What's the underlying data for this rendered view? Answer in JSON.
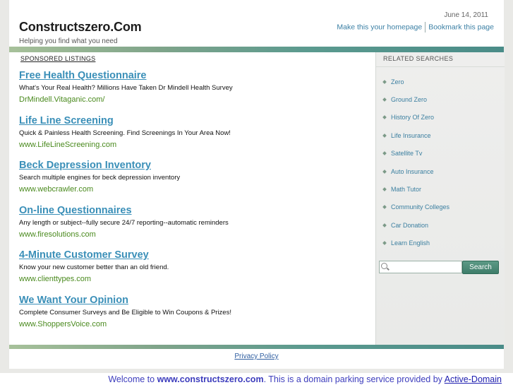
{
  "header": {
    "site_title": "Constructszero.Com",
    "tagline": "Helping you find what you need",
    "date": "June 14, 2011",
    "make_homepage": "Make this your homepage",
    "bookmark": "Bookmark this page"
  },
  "sponsored": {
    "label": "SPONSORED LISTINGS",
    "listings": [
      {
        "title": "Free Health Questionnaire",
        "desc": "What's Your Real Health? Millions Have Taken Dr Mindell Health Survey",
        "url": "DrMindell.Vitaganic.com/"
      },
      {
        "title": "Life Line Screening",
        "desc": "Quick & Painless Health Screening. Find Screenings In Your Area Now!",
        "url": "www.LifeLineScreening.com"
      },
      {
        "title": "Beck Depression Inventory",
        "desc": "Search multiple engines for beck depression inventory",
        "url": "www.webcrawler.com"
      },
      {
        "title": "On-line Questionnaires",
        "desc": "Any length or subject--fully secure 24/7 reporting--automatic reminders",
        "url": "www.firesolutions.com"
      },
      {
        "title": "4-Minute Customer Survey",
        "desc": "Know your new customer better than an old friend.",
        "url": "www.clienttypes.com"
      },
      {
        "title": "We Want Your Opinion",
        "desc": "Complete Consumer Surveys and Be Eligible to Win Coupons & Prizes!",
        "url": "www.ShoppersVoice.com"
      }
    ]
  },
  "related": {
    "label": "RELATED SEARCHES",
    "items": [
      "Zero",
      "Ground Zero",
      "History Of Zero",
      "Life Insurance",
      "Satellite Tv",
      "Auto Insurance",
      "Math Tutor",
      "Community Colleges",
      "Car Donation",
      "Learn English"
    ],
    "search_button": "Search",
    "search_value": ""
  },
  "footer": {
    "privacy": "Privacy Policy"
  },
  "welcome": {
    "prefix": "Welcome to ",
    "domain": "www.constructszero.com",
    "middle": ". This is a domain parking service provided by ",
    "provider": "Active-Domain"
  },
  "colors": {
    "accent_bar": "#5b9a8f",
    "link_blue": "#3a8fb8",
    "url_green": "#4a8a1e",
    "search_button": "#4a8c78"
  }
}
